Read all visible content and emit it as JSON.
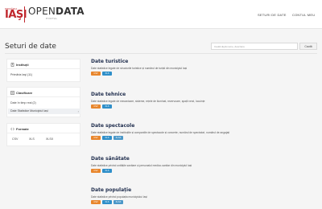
{
  "header": {
    "logo_top": "PRIMĂRIA",
    "logo_main": "IAŞI",
    "brand_open": "OPEN",
    "brand_data": "DATA",
    "brand_sub": "PORTAL",
    "nav": [
      "SETURI DE DATE",
      "CONTUL MEU"
    ]
  },
  "page": {
    "title": "Seturi de date",
    "search_placeholder": "Caută după nume, descriere",
    "search_button": "Caută"
  },
  "facets": {
    "institutii": {
      "title": "Instituții",
      "items": [
        {
          "label": "Primăria Iaşi (11)"
        }
      ]
    },
    "clasificare": {
      "title": "Clasificare",
      "items": [
        {
          "label": "Date în timp real (2)"
        },
        {
          "label": "Date Statistice Municipiul Iași"
        }
      ]
    },
    "formate": {
      "title": "Formate",
      "items": [
        "CSV",
        "XLS",
        "XLSX"
      ]
    }
  },
  "colors": {
    "csv": "#e8862c",
    "xls": "#2f8fc9",
    "xlsx": "#4a97c8",
    "title": "#1f2d4d",
    "brand": "#c0272d"
  },
  "datasets": [
    {
      "title": "Date turistice",
      "description": "Date statistice legate de structurile turistice și numărul de turiști din municipiul Iași",
      "formats": [
        "CSV",
        "XLS"
      ]
    },
    {
      "title": "Date tehnice",
      "description": "Date statistice legate de mecanizare, sisteme, rețele de iluminat, rezervoare, spații verzi, locuințe",
      "formats": [
        "CSV",
        "XLS"
      ]
    },
    {
      "title": "Date spectacole",
      "description": "Date statistice legate de instituțiile și companiile de spectacole și concerte, numărul de spectatori, numărul de angajați",
      "formats": [
        "CSV",
        "XLS",
        "XLSX"
      ]
    },
    {
      "title": "Date sănătate",
      "description": "Date statistice privind unitățile sanitare și personalul medico-sanitar din municipiul Iași",
      "formats": [
        "CSV",
        "XLS"
      ]
    },
    {
      "title": "Date populație",
      "description": "Date statistice privind populația municipiului Iași",
      "formats": [
        "CSV",
        "XLS",
        "XLSX"
      ]
    }
  ]
}
